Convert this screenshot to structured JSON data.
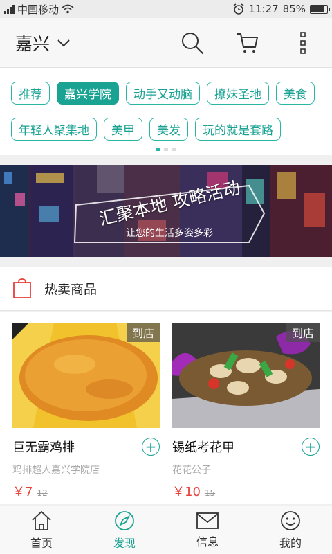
{
  "status_bar": {
    "carrier": "中国移动",
    "time": "11:27",
    "battery": "85%"
  },
  "header": {
    "city": "嘉兴"
  },
  "tags": {
    "row1": [
      "推荐",
      "嘉兴学院",
      "动手又动脑",
      "撩妹圣地",
      "美食"
    ],
    "row2": [
      "年轻人聚集地",
      "美甲",
      "美发",
      "玩的就是套路"
    ],
    "active": "嘉兴学院"
  },
  "banner": {
    "title": "汇聚本地 攻略活动",
    "subtitle": "让您的生活多姿多彩"
  },
  "hot": {
    "title": "热卖商品"
  },
  "products": [
    {
      "badge": "到店",
      "name": "巨无霸鸡排",
      "shop": "鸡排超人嘉兴学院店",
      "price": "￥7",
      "old_price": "12"
    },
    {
      "badge": "到店",
      "name": "锡纸考花甲",
      "shop": "花花公子",
      "price": "￥10",
      "old_price": "15"
    }
  ],
  "nav": {
    "items": [
      {
        "label": "首页",
        "icon": "home-icon"
      },
      {
        "label": "发现",
        "icon": "compass-icon"
      },
      {
        "label": "信息",
        "icon": "mail-icon"
      },
      {
        "label": "我的",
        "icon": "smiley-icon"
      }
    ],
    "active_index": 1
  },
  "colors": {
    "accent": "#1aa393",
    "price": "#e8403a"
  }
}
